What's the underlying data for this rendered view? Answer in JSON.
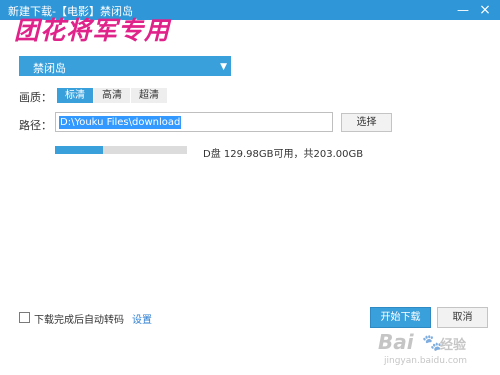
{
  "window": {
    "title": "新建下载-【电影】禁闭岛",
    "minimize_glyph": "—",
    "close_glyph": "×"
  },
  "watermark_text": "团花将军专用",
  "video_select": {
    "value": "禁闭岛",
    "arrow_icon": "chevron-down-icon"
  },
  "quality": {
    "label": "画质：",
    "options": [
      "标清",
      "高清",
      "超清"
    ],
    "selected": "标清"
  },
  "path": {
    "label": "路径：",
    "value": "D:\\Youku Files\\download",
    "browse_label": "选择"
  },
  "disk": {
    "used_fraction": 0.36,
    "info": "D盘 129.98GB可用，共203.00GB"
  },
  "footer": {
    "auto_transcode_label": "下载完成后自动转码",
    "auto_transcode_checked": false,
    "settings_label": "设置",
    "start_label": "开始下载",
    "cancel_label": "取消"
  },
  "baidu_watermark": {
    "brand": "Bai",
    "paw": "🐾",
    "zh": "经验",
    "url": "jingyan.baidu.com"
  },
  "colors": {
    "accent": "#3aa0dc",
    "titlebar": "#2f97d8",
    "watermark": "#e0238a",
    "link": "#2e7fd1"
  }
}
